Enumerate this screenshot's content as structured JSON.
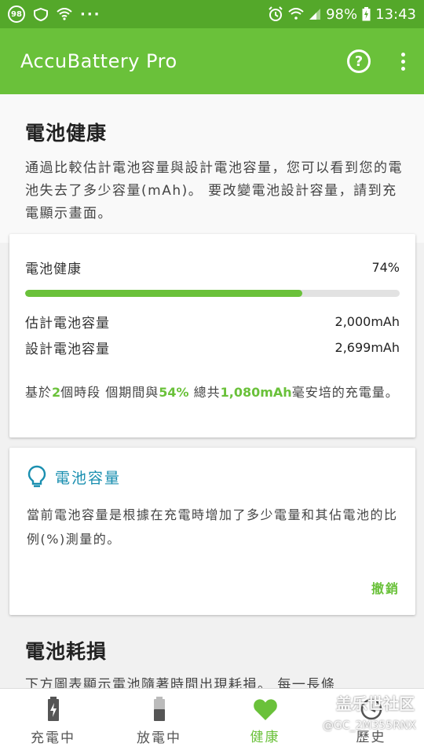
{
  "status_bar": {
    "notif_badge": "98",
    "dots": "···",
    "battery_pct": "98%",
    "time": "13:43"
  },
  "app": {
    "title": "AccuBattery Pro",
    "help_glyph": "?"
  },
  "health": {
    "title": "電池健康",
    "desc": "通過比較估計電池容量與設計電池容量，您可以看到您的電池失去了多少容量(mAh)。 要改變電池設計容量，請到充電顯示畫面。",
    "card": {
      "label": "電池健康",
      "value": "74%",
      "progress_pct": 74,
      "estimated_label": "估計電池容量",
      "estimated_value": "2,000mAh",
      "design_label": "設計電池容量",
      "design_value": "2,699mAh",
      "summary_prefix": "基於",
      "summary_sessions": "2",
      "summary_mid": "個時段 個期間與",
      "summary_pct": "54%",
      "summary_mid2": " 總共",
      "summary_mah": "1,080mAh",
      "summary_suffix": "毫安培的充電量。"
    }
  },
  "tip": {
    "title": "電池容量",
    "body": "當前電池容量是根據在充電時增加了多少電量和其佔電池的比例(%)測量的。",
    "undo_label": "撤銷"
  },
  "wear": {
    "title": "電池耗損",
    "desc": "下方圖表顯示電池隨著時間出現耗損。 每一長條"
  },
  "bottom_nav": {
    "items": [
      {
        "label": "充電中",
        "icon": "battery-charging-icon"
      },
      {
        "label": "放電中",
        "icon": "battery-discharging-icon"
      },
      {
        "label": "健康",
        "icon": "heart-icon"
      },
      {
        "label": "歷史",
        "icon": "history-icon"
      }
    ],
    "active": "健康"
  },
  "watermark": {
    "line1": "盖乐世社区",
    "line2": "@GC_2M355RNX"
  },
  "colors": {
    "status_bar": "#54a82a",
    "app_bar": "#6ac13a",
    "accent": "#6ac13a",
    "tip_title": "#1a8fb0"
  }
}
